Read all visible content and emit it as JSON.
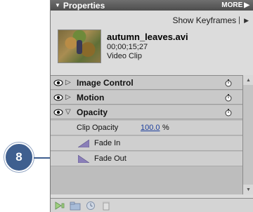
{
  "callout": {
    "number": "8"
  },
  "panel": {
    "title": "Properties",
    "more_label": "MORE",
    "show_keyframes": "Show Keyframes"
  },
  "clip": {
    "name": "autumn_leaves.avi",
    "timecode": "00;00;15;27",
    "type": "Video Clip"
  },
  "effects": [
    {
      "label": "Image Control",
      "expanded": false
    },
    {
      "label": "Motion",
      "expanded": false
    },
    {
      "label": "Opacity",
      "expanded": true
    }
  ],
  "opacity": {
    "clip_opacity_label": "Clip Opacity",
    "clip_opacity_value": "100.0",
    "clip_opacity_unit": "%",
    "fade_in_label": "Fade In",
    "fade_out_label": "Fade Out"
  },
  "icons": {
    "bottom_tools": [
      "add-effect-icon",
      "folder-icon",
      "clock-icon",
      "trash-icon"
    ]
  },
  "colors": {
    "callout": "#3f5f8f",
    "titlebar": "#555555",
    "link_blue": "#1a3d9c"
  }
}
